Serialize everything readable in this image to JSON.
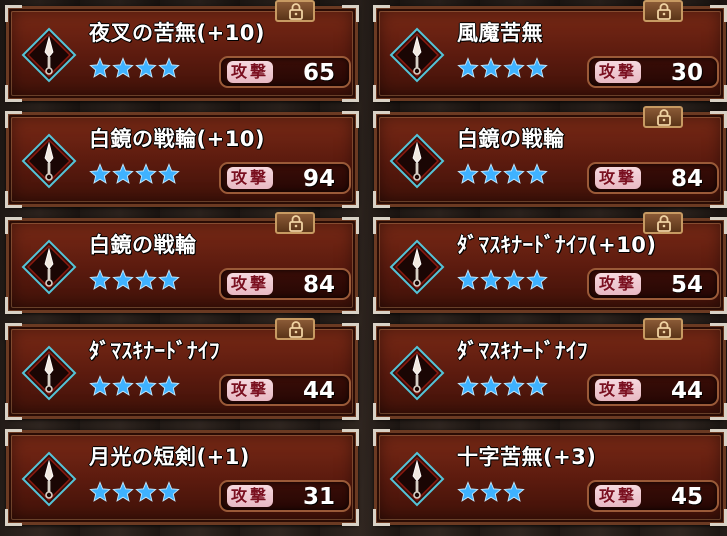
{
  "stat_label": "攻撃",
  "colors": {
    "card_border": "#6b3a22",
    "star": "#3fb2ff",
    "stat_label_bg": "#f6d9df",
    "stat_label_text": "#7a1020",
    "icon_outline": "#54c4d8"
  },
  "items": [
    {
      "name": "夜叉の苦無(+10)",
      "stars": 4,
      "attack": "65",
      "locked": true,
      "icon": "kunai-icon"
    },
    {
      "name": "風魔苦無",
      "stars": 4,
      "attack": "30",
      "locked": true,
      "icon": "kunai-icon"
    },
    {
      "name": "白鏡の戦輪(+10)",
      "stars": 4,
      "attack": "94",
      "locked": false,
      "icon": "kunai-icon"
    },
    {
      "name": "白鏡の戦輪",
      "stars": 4,
      "attack": "84",
      "locked": true,
      "icon": "kunai-icon"
    },
    {
      "name": "白鏡の戦輪",
      "stars": 4,
      "attack": "84",
      "locked": true,
      "icon": "kunai-icon"
    },
    {
      "name": "ﾀﾞﾏｽｷﾅｰﾄﾞﾅｲﾌ(+10)",
      "stars": 4,
      "attack": "54",
      "locked": true,
      "icon": "kunai-icon"
    },
    {
      "name": "ﾀﾞﾏｽｷﾅｰﾄﾞﾅｲﾌ",
      "stars": 4,
      "attack": "44",
      "locked": true,
      "icon": "kunai-icon"
    },
    {
      "name": "ﾀﾞﾏｽｷﾅｰﾄﾞﾅｲﾌ",
      "stars": 4,
      "attack": "44",
      "locked": true,
      "icon": "kunai-icon"
    },
    {
      "name": "月光の短剣(+1)",
      "stars": 4,
      "attack": "31",
      "locked": false,
      "icon": "kunai-icon"
    },
    {
      "name": "十字苦無(+3)",
      "stars": 3,
      "attack": "45",
      "locked": false,
      "icon": "kunai-icon"
    }
  ]
}
